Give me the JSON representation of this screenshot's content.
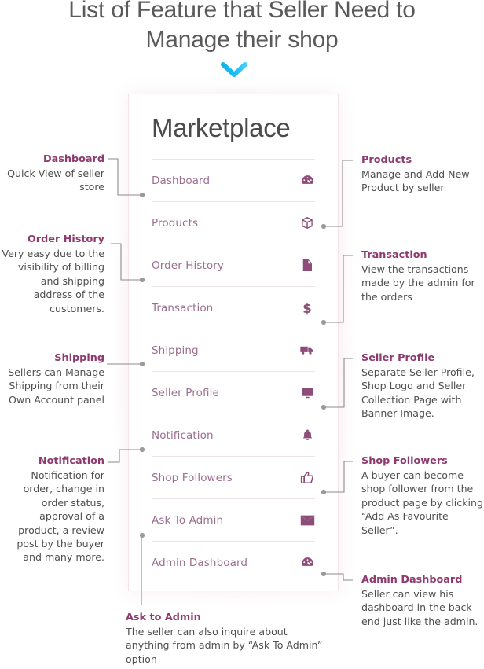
{
  "page": {
    "title_line1": "List of Feature that Seller Need to",
    "title_line2": "Manage their shop",
    "chevron_icon": "chevron-down-icon",
    "accent_chevron_color": "#24bdf0",
    "heading_color": "#8e3a6e",
    "menu_text_color": "#9b6f90",
    "icon_color": "#8e4c78",
    "body_text_color": "#4f4f4f"
  },
  "card": {
    "title": "Marketplace",
    "items": [
      {
        "label": "Dashboard",
        "icon": "gauge-icon"
      },
      {
        "label": "Products",
        "icon": "box-icon"
      },
      {
        "label": "Order History",
        "icon": "document-icon"
      },
      {
        "label": "Transaction",
        "icon": "dollar-icon"
      },
      {
        "label": "Shipping",
        "icon": "truck-icon"
      },
      {
        "label": "Seller Profile",
        "icon": "monitor-icon"
      },
      {
        "label": "Notification",
        "icon": "bell-icon"
      },
      {
        "label": "Shop Followers",
        "icon": "thumbs-up-icon"
      },
      {
        "label": "Ask To Admin",
        "icon": "envelope-icon"
      },
      {
        "label": "Admin Dashboard",
        "icon": "gauge-icon"
      }
    ]
  },
  "annotations": {
    "dashboard": {
      "heading": "Dashboard",
      "body": "Quick View of seller store"
    },
    "order_history": {
      "heading": "Order History",
      "body": "Very easy due to the visibility of billing and shipping address of the customers."
    },
    "shipping": {
      "heading": "Shipping",
      "body": "Sellers can Manage Shipping from their Own Account panel"
    },
    "notification": {
      "heading": "Notification",
      "body": "Notification for order,  change in order  status, approval of  a product, a review post by the buyer and many more."
    },
    "products": {
      "heading": "Products",
      "body": "Manage and Add New Product by seller"
    },
    "transaction": {
      "heading": "Transaction",
      "body": "View the transactions made by the admin for the orders"
    },
    "seller_profile": {
      "heading": "Seller Profile",
      "body": "Separate Seller Profile, Shop Logo and Seller Collection Page with Banner Image."
    },
    "shop_followers": {
      "heading": "Shop Followers",
      "body": "A buyer can become shop follower from the product page by clicking “Add As Favourite Seller”."
    },
    "admin_dashboard": {
      "heading": "Admin Dashboard",
      "body": "Seller can view his dashboard in the back-end just like the admin."
    },
    "ask_to_admin": {
      "heading": "Ask to Admin",
      "body": "The seller can also inquire about anything from admin by “Ask To Admin” option"
    }
  }
}
